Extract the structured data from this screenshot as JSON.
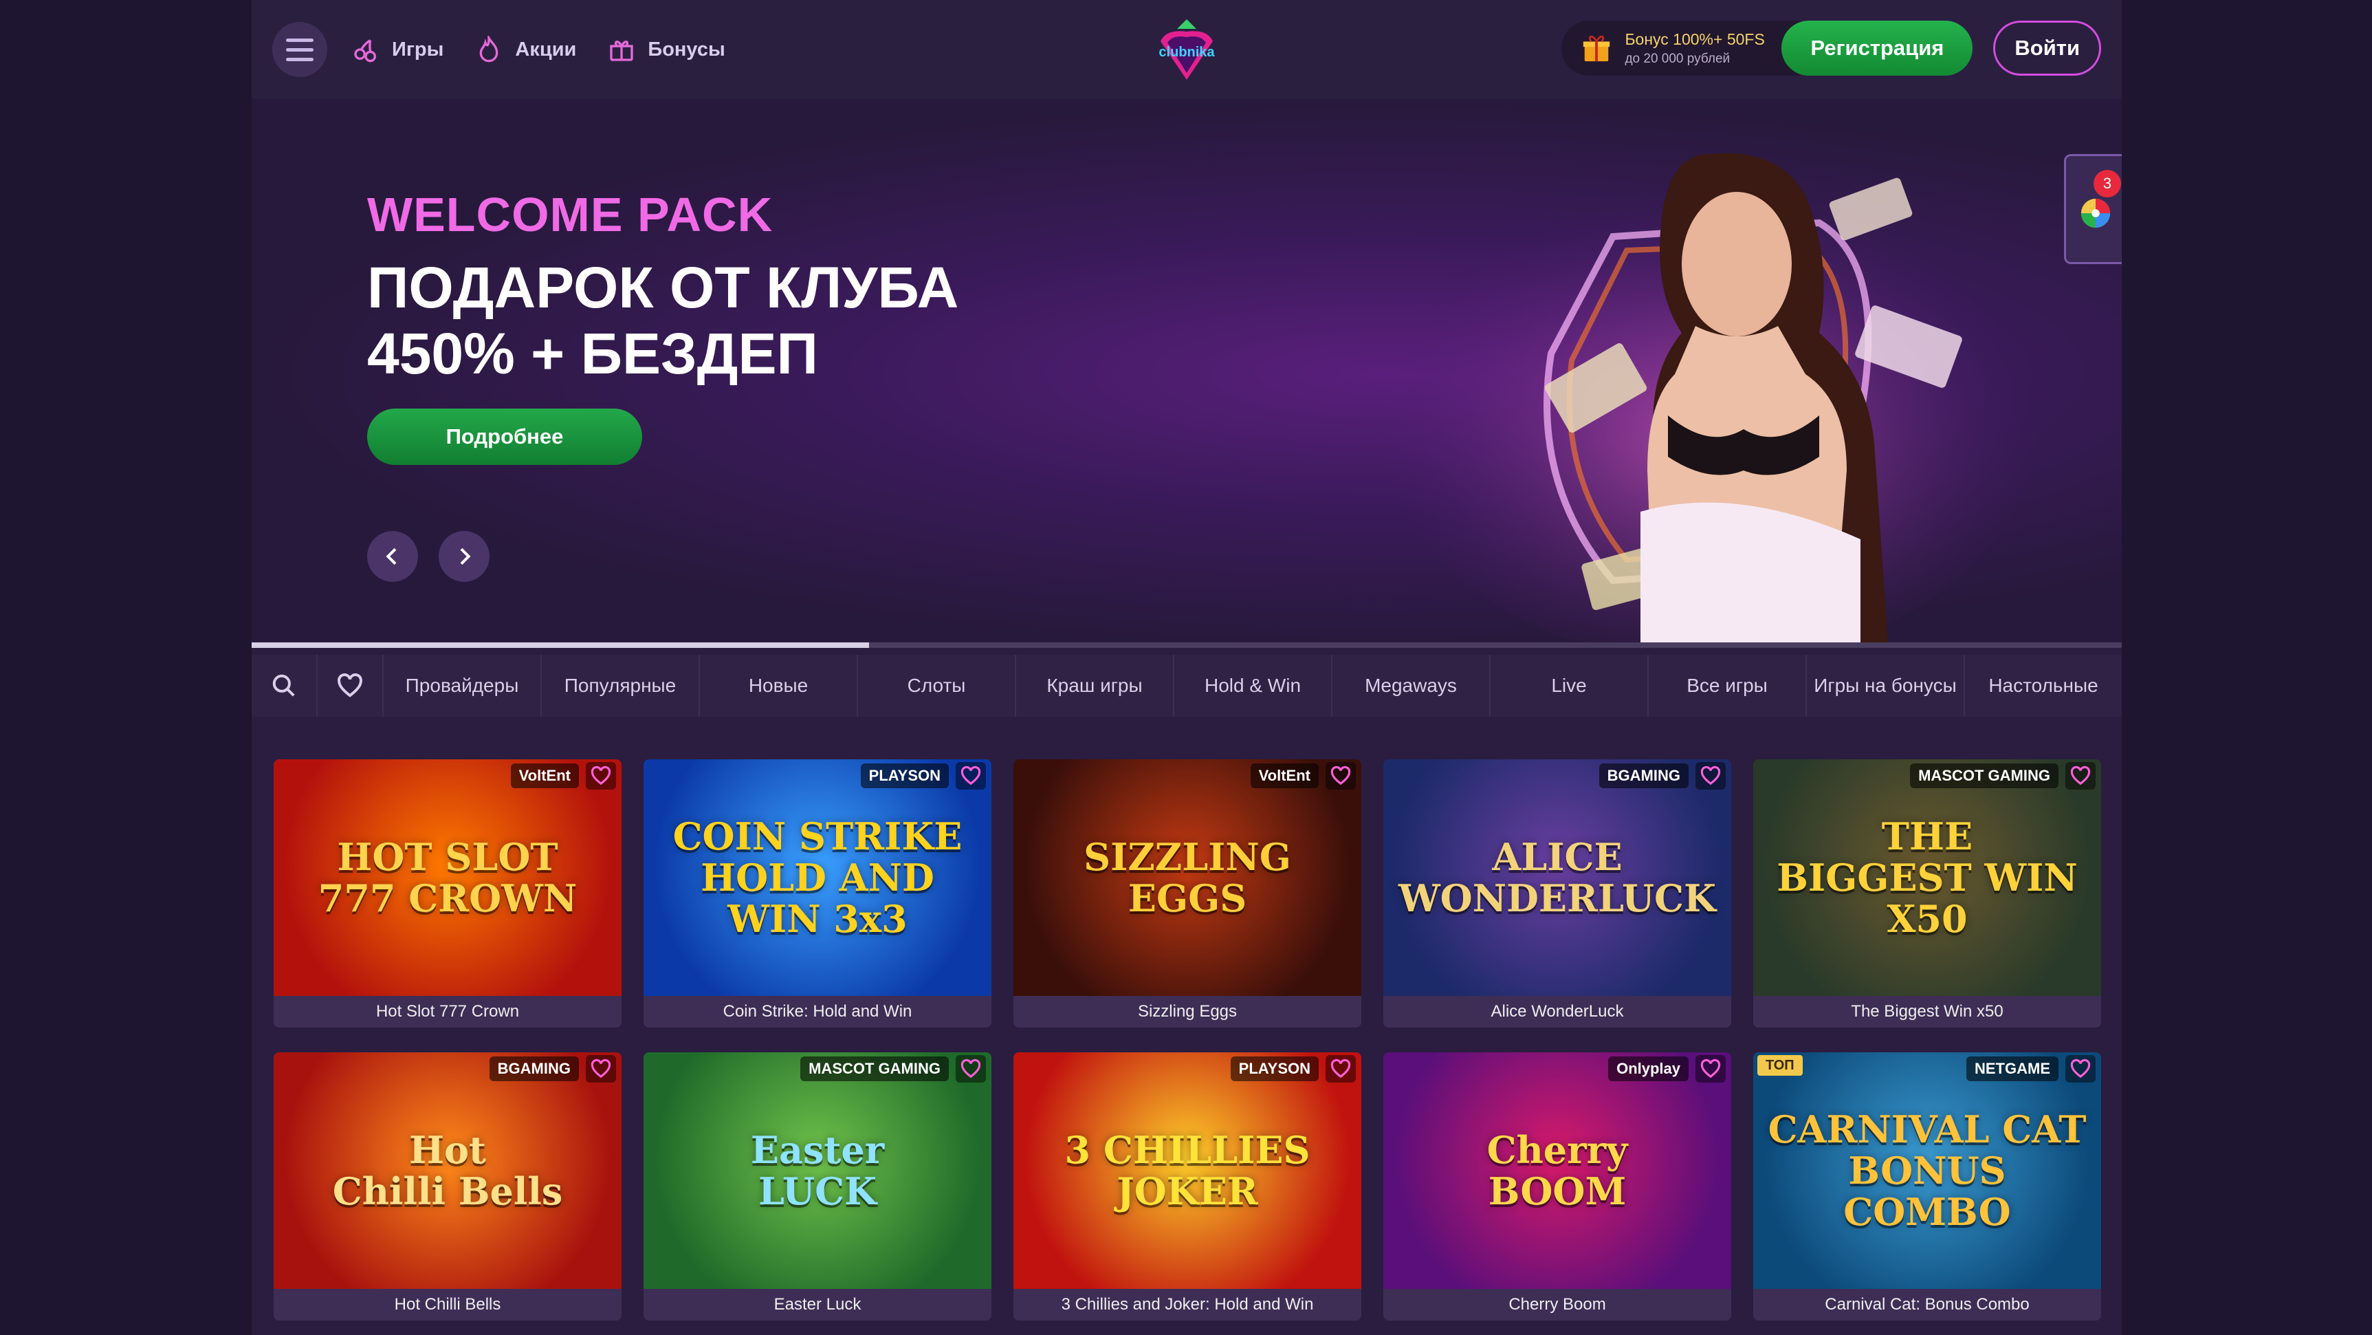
{
  "header": {
    "nav": [
      {
        "label": "Игры",
        "icon": "cherry-icon"
      },
      {
        "label": "Акции",
        "icon": "fire-icon"
      },
      {
        "label": "Бонусы",
        "icon": "gift-icon"
      }
    ],
    "logo_text": "clubnika",
    "bonus_line1": "Бонус 100%+ 50FS",
    "bonus_line2": "до 20 000 рублей",
    "register_label": "Регистрация",
    "login_label": "Войти"
  },
  "hero": {
    "subtitle": "WELCOME PACK",
    "title": "ПОДАРОК ОТ КЛУБА\n450% + БЕЗДЕП",
    "cta_label": "Подробнее",
    "slide_progress": 0.33,
    "notification_count": "3"
  },
  "tabs": [
    "Провайдеры",
    "Популярные",
    "Новые",
    "Слоты",
    "Краш игры",
    "Hold & Win",
    "Megaways",
    "Live",
    "Все игры",
    "Игры на бонусы",
    "Настольные"
  ],
  "games": [
    {
      "title": "Hot Slot 777 Crown",
      "art": "HOT SLOT\n777 CROWN",
      "provider": "VoltEnt",
      "colors": [
        "#b3120c",
        "#ff7a00"
      ],
      "text_color": "#ffd34d"
    },
    {
      "title": "Coin Strike: Hold and Win",
      "art": "COIN STRIKE\nHOLD AND WIN 3x3",
      "provider": "PLAYSON",
      "colors": [
        "#0b3aa8",
        "#3aa0ff"
      ],
      "text_color": "#ffd21e"
    },
    {
      "title": "Sizzling Eggs",
      "art": "SIZZLING\nEGGS",
      "provider": "VoltEnt",
      "colors": [
        "#3a0f0a",
        "#c43a12"
      ],
      "text_color": "#ffcf3a"
    },
    {
      "title": "Alice WonderLuck",
      "art": "ALICE\nWONDERLUCK",
      "provider": "BGAMING",
      "colors": [
        "#1d2a6a",
        "#6a3fa0"
      ],
      "text_color": "#f3d37a"
    },
    {
      "title": "The Biggest Win x50",
      "art": "THE\nBIGGEST WIN\nX50",
      "provider": "MASCOT GAMING",
      "colors": [
        "#2a3a2a",
        "#6b5a2e"
      ],
      "text_color": "#ffd23a"
    },
    {
      "title": "Hot Chilli Bells",
      "art": "Hot\nChilli Bells",
      "provider": "BGAMING",
      "colors": [
        "#a8120e",
        "#ff8a1a"
      ],
      "text_color": "#ffe08a"
    },
    {
      "title": "Easter Luck",
      "art": "Easter\nLUCK",
      "provider": "MASCOT GAMING",
      "colors": [
        "#1f6a2a",
        "#6fc24a"
      ],
      "text_color": "#8fe3ff"
    },
    {
      "title": "3 Chillies and Joker: Hold and Win",
      "art": "3 CHILLIES\nJOKER",
      "provider": "PLAYSON",
      "colors": [
        "#c0120e",
        "#ffcf2a"
      ],
      "text_color": "#ffe23a"
    },
    {
      "title": "Cherry Boom",
      "art": "Cherry\nBOOM",
      "provider": "Onlyplay",
      "colors": [
        "#5a0f7a",
        "#d81a6a"
      ],
      "text_color": "#ffd84a"
    },
    {
      "title": "Carnival Cat: Bonus Combo",
      "art": "CARNIVAL CAT\nBONUS COMBO",
      "provider": "NETGAME",
      "badge": "ТОП",
      "colors": [
        "#0c4a7a",
        "#3a9ad0"
      ],
      "text_color": "#ffc23a"
    }
  ]
}
